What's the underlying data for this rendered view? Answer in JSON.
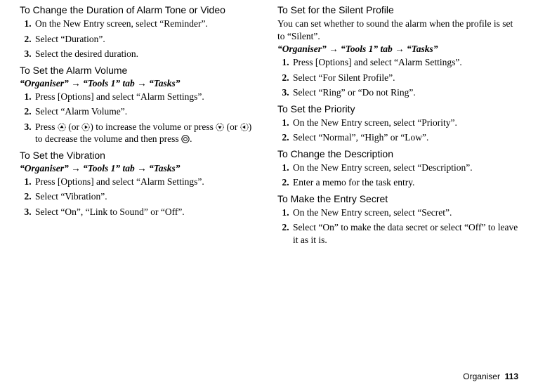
{
  "left": {
    "sec1": {
      "title": "To Change the Duration of Alarm Tone or Video",
      "steps": [
        "On the New Entry screen, select “Reminder”.",
        "Select “Duration”.",
        "Select the desired duration."
      ]
    },
    "sec2": {
      "title": "To Set the Alarm Volume",
      "path": "“Organiser” → “Tools 1” tab → “Tasks”",
      "steps": [
        "Press [Options] and select “Alarm Settings”.",
        "Select “Alarm Volume”."
      ],
      "step3": {
        "t1": "Press ",
        "t2": " (or ",
        "t3": ") to increase the volume or press ",
        "t4": " (or ",
        "t5": ") to decrease the volume and then press ",
        "t6": "."
      }
    },
    "sec3": {
      "title": "To Set the Vibration",
      "path": "“Organiser” → “Tools 1” tab → “Tasks”",
      "steps": [
        "Press [Options] and select “Alarm Settings”.",
        "Select “Vibration”.",
        "Select “On”, “Link to Sound” or “Off”."
      ]
    }
  },
  "right": {
    "sec1": {
      "title": "To Set for the Silent Profile",
      "lead": "You can set whether to sound the alarm when the profile is set to “Silent”.",
      "path": "“Organiser” → “Tools 1” tab → “Tasks”",
      "steps": [
        "Press [Options] and select “Alarm Settings”.",
        "Select “For Silent Profile”.",
        "Select “Ring” or “Do not Ring”."
      ]
    },
    "sec2": {
      "title": "To Set the Priority",
      "steps": [
        "On the New Entry screen, select “Priority”.",
        "Select “Normal”, “High” or “Low”."
      ]
    },
    "sec3": {
      "title": "To Change the Description",
      "steps": [
        "On the New Entry screen, select “Description”.",
        "Enter a memo for the task entry."
      ]
    },
    "sec4": {
      "title": "To Make the Entry Secret",
      "steps": [
        "On the New Entry screen, select “Secret”.",
        "Select “On” to make the data secret or select “Off” to leave it as it is."
      ]
    }
  },
  "footer": {
    "label": "Organiser",
    "page": "113"
  }
}
